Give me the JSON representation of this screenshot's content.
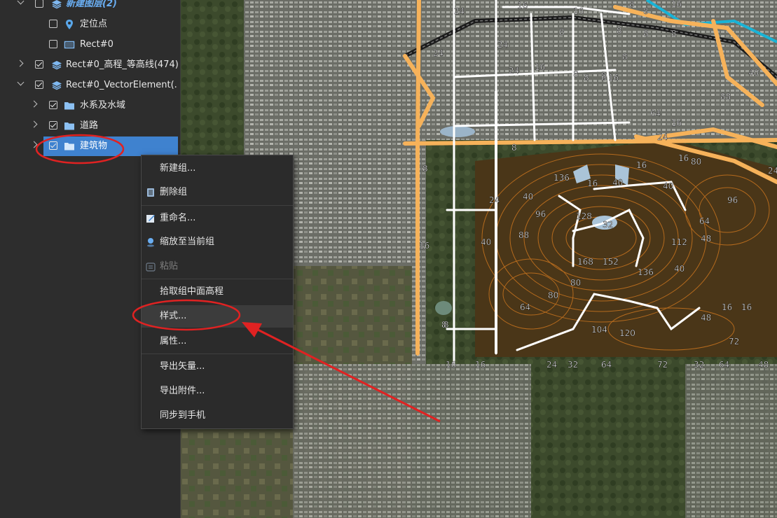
{
  "layers": [
    {
      "label": "新建图层(2)",
      "checked": false
    },
    {
      "label": "定位点",
      "checked": false
    },
    {
      "label": "Rect#0",
      "checked": false
    },
    {
      "label": "Rect#0_高程_等高线(474)",
      "checked": true
    },
    {
      "label": "Rect#0_VectorElement(...",
      "checked": true
    },
    {
      "label": "水系及水域",
      "checked": true
    },
    {
      "label": "道路",
      "checked": true
    },
    {
      "label": "建筑物",
      "checked": true
    }
  ],
  "context_menu": {
    "items": [
      {
        "label": "新建组..."
      },
      {
        "label": "删除组"
      },
      {
        "label": "重命名..."
      },
      {
        "label": "缩放至当前组"
      },
      {
        "label": "粘贴",
        "disabled": true
      },
      {
        "label": "拾取组中面高程"
      },
      {
        "label": "样式..."
      },
      {
        "label": "属性..."
      },
      {
        "label": "导出矢量..."
      },
      {
        "label": "导出附件..."
      },
      {
        "label": "同步到手机"
      }
    ]
  },
  "contour_labels": [
    "24",
    "16",
    "16",
    "8",
    "8",
    "8",
    "8",
    "16",
    "8",
    "8",
    "24",
    "24",
    "24",
    "16",
    "8",
    "8",
    "8",
    "16",
    "40",
    "8",
    "8",
    "8",
    "88",
    "64",
    "16",
    "8",
    "24",
    "8",
    "24",
    "16",
    "16",
    "16",
    "80",
    "40",
    "136",
    "16",
    "40",
    "40",
    "24",
    "96",
    "128",
    "32",
    "96",
    "64",
    "88",
    "112",
    "48",
    "16",
    "40",
    "168",
    "152",
    "136",
    "40",
    "80",
    "64",
    "80",
    "16",
    "104",
    "120",
    "48",
    "72",
    "8",
    "8",
    "16",
    "16",
    "24",
    "32",
    "64",
    "72",
    "32",
    "64",
    "48"
  ],
  "colors": {
    "selection": "#3f82cf",
    "annotation_red": "#e02222",
    "road_orange": "#f6b25a",
    "road_white": "#ffffff",
    "contour": "#c8741f"
  },
  "icons": {
    "layer_group": "layers-icon",
    "point": "map-pin-icon",
    "rect": "rectangle-icon",
    "folder": "folder-icon"
  }
}
